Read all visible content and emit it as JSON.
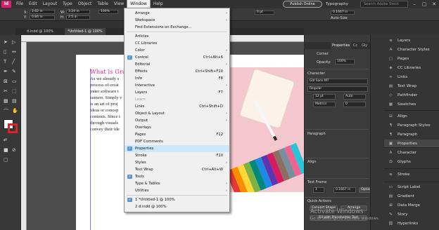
{
  "menubar": {
    "logo": "Id",
    "items": [
      "File",
      "Edit",
      "Layout",
      "Type",
      "Object",
      "Table",
      "View",
      "Window",
      "Help"
    ],
    "publish_label": "Publish Online",
    "workspace_label": "Typography",
    "stock_placeholder": "Search Adobe Stock"
  },
  "control": {
    "x_label": "X:",
    "x_value": "2.62 in",
    "y_label": "Y:",
    "y_value": "0.84 in",
    "w_label": "W:",
    "w_value": "3.24 in",
    "h_label": "H:",
    "h_value": "2.5 in",
    "zoom_value": "100%",
    "stroke_value": "0 pt",
    "gutter_value": "0.1667 in",
    "auto_size": "Auto-Size"
  },
  "doc_tabs": [
    "d.indd @ 100%",
    "*Untitled-1 @ 100%"
  ],
  "document": {
    "heading": "What is Gra",
    "body_lines": [
      "As we already s",
      "process of creat",
      "puter software t",
      "sumers. Simply v",
      "is an art of proj",
      "ideas or concep",
      "contents. Since t",
      "through visuals",
      "convey their ide"
    ]
  },
  "window_menu": {
    "items": [
      {
        "label": "Arrange",
        "submenu": true
      },
      {
        "label": "Workspace",
        "submenu": true
      },
      {
        "label": "Find Extensions on Exchange..."
      },
      {
        "sep": true
      },
      {
        "label": "Articles"
      },
      {
        "label": "CC Libraries"
      },
      {
        "label": "Color",
        "submenu": true
      },
      {
        "label": "Control",
        "shortcut": "Ctrl+Alt+6",
        "checked": true
      },
      {
        "label": "Editorial",
        "submenu": true
      },
      {
        "label": "Effects",
        "shortcut": "Ctrl+Shift+F10"
      },
      {
        "label": "Info",
        "shortcut": "F8"
      },
      {
        "label": "Interactive",
        "submenu": true
      },
      {
        "label": "Layers",
        "shortcut": "F7"
      },
      {
        "label": "Learn",
        "disabled": true
      },
      {
        "label": "Links",
        "shortcut": "Ctrl+Shift+D"
      },
      {
        "label": "Object & Layout",
        "submenu": true
      },
      {
        "label": "Output",
        "submenu": true
      },
      {
        "label": "Overlays"
      },
      {
        "label": "Pages",
        "shortcut": "F12"
      },
      {
        "label": "PDF Comments"
      },
      {
        "label": "Properties",
        "checked": true,
        "highlight": true
      },
      {
        "label": "Stroke",
        "shortcut": "F10"
      },
      {
        "label": "Styles",
        "submenu": true
      },
      {
        "label": "Text Wrap",
        "shortcut": "Ctrl+Alt+W"
      },
      {
        "label": "Tools",
        "checked": true
      },
      {
        "label": "Type & Tables",
        "submenu": true
      },
      {
        "label": "Utilities",
        "submenu": true
      },
      {
        "sep": true
      },
      {
        "label": "1 *Untitled-1 @ 100%",
        "checked": true
      },
      {
        "label": "2 d.indd @ 100%"
      }
    ]
  },
  "properties_panel": {
    "tabs": [
      "Properties",
      "Cc",
      "Gly"
    ],
    "corner_label": "Corner",
    "opacity_label": "Opacity:",
    "opacity_value": "100%",
    "character_header": "Character",
    "font_value": "Gill Sans MT",
    "style_value": "Regular",
    "size_value": "12 pt",
    "leading_value": "Auto",
    "kerning_value": "Metrics",
    "tracking_value": "0",
    "paragraph_header": "Paragraph",
    "align_header": "Align",
    "text_frame_header": "Text Frame",
    "columns_value": "1",
    "gutter_value": "0.1667 in",
    "options_label": "Options",
    "quick_actions_header": "Quick Actions",
    "convert_shape": "Convert Shape",
    "arrange": "Arrange",
    "fill_placeholder": "Fill with Placeholder Text"
  },
  "right_panels": [
    {
      "label": "Layers",
      "icon": "≡"
    },
    {
      "label": "Character Styles",
      "icon": "A"
    },
    {
      "label": "Pages",
      "icon": "▢"
    },
    {
      "label": "CC Libraries",
      "icon": "◈"
    },
    {
      "label": "Links",
      "icon": "∞"
    },
    {
      "label": "Text Wrap",
      "icon": "▤"
    },
    {
      "label": "Pathfinder",
      "icon": "◇"
    },
    {
      "label": "Swatches",
      "icon": "▦"
    },
    {
      "label": "Align",
      "icon": "⊟"
    },
    {
      "label": "Paragraph Styles",
      "icon": "¶"
    },
    {
      "label": "Paragraph",
      "icon": "¶"
    },
    {
      "label": "Properties",
      "icon": "▣"
    },
    {
      "label": "Character",
      "icon": "A"
    },
    {
      "label": "Glyphs",
      "icon": "Ω"
    },
    {
      "label": "Stroke",
      "icon": "≡"
    },
    {
      "label": "Script Label",
      "icon": "▭"
    },
    {
      "label": "Gradient",
      "icon": "▤"
    },
    {
      "label": "Data Merge",
      "icon": "⊞"
    },
    {
      "label": "Story",
      "icon": "✎"
    },
    {
      "label": "Hyperlinks",
      "icon": "⛓"
    }
  ],
  "watermark": {
    "title": "Activate Windows",
    "subtitle": "Go to Settings to activate Windows."
  }
}
